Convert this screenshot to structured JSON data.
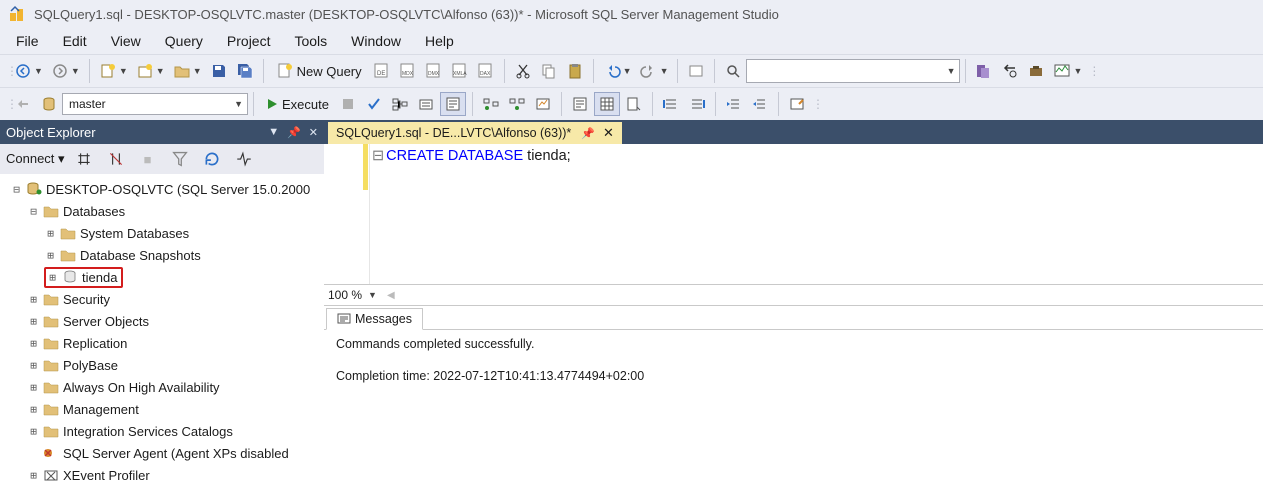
{
  "title_bar": {
    "text": "SQLQuery1.sql - DESKTOP-OSQLVTC.master (DESKTOP-OSQLVTC\\Alfonso (63))* - Microsoft SQL Server Management Studio"
  },
  "menu": {
    "file": "File",
    "edit": "Edit",
    "view": "View",
    "query": "Query",
    "project": "Project",
    "tools": "Tools",
    "window": "Window",
    "help": "Help"
  },
  "toolbar1": {
    "new_query": "New Query",
    "search_value": ""
  },
  "toolbar2": {
    "database": "master",
    "execute": "Execute"
  },
  "object_explorer": {
    "title": "Object Explorer",
    "connect": "Connect",
    "server": "DESKTOP-OSQLVTC (SQL Server 15.0.2000",
    "nodes": {
      "databases": "Databases",
      "system_db": "System Databases",
      "db_snapshots": "Database Snapshots",
      "tienda": "tienda",
      "security": "Security",
      "server_objects": "Server Objects",
      "replication": "Replication",
      "polybase": "PolyBase",
      "always_on": "Always On High Availability",
      "management": "Management",
      "isc": "Integration Services Catalogs",
      "agent": "SQL Server Agent (Agent XPs disabled",
      "xevent": "XEvent Profiler"
    }
  },
  "editor": {
    "tab_label": "SQLQuery1.sql - DE...LVTC\\Alfonso (63))*",
    "zoom": "100 %",
    "code_kw": "CREATE DATABASE",
    "code_rest": " tienda;"
  },
  "messages": {
    "tab": "Messages",
    "line1": "Commands completed successfully.",
    "line2": "Completion time: 2022-07-12T10:41:13.4774494+02:00"
  }
}
